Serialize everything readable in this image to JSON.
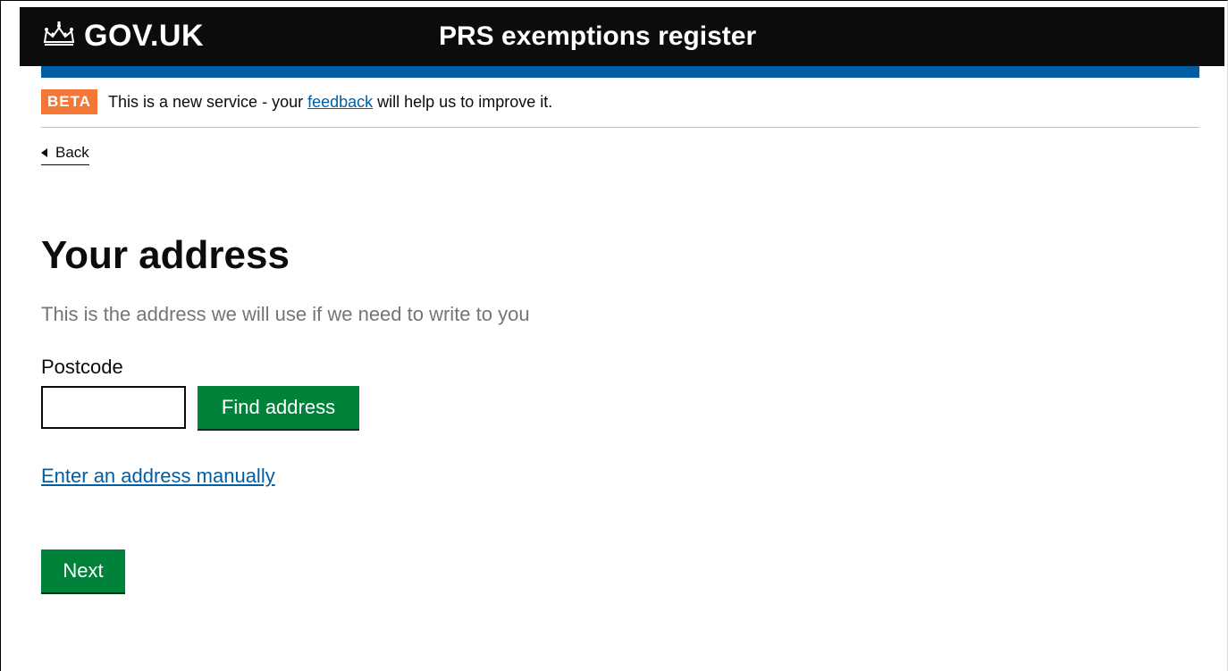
{
  "header": {
    "logo_text": "GOV.UK",
    "service_name": "PRS exemptions register"
  },
  "phase_banner": {
    "tag": "BETA",
    "text_before": "This is a new service - your ",
    "link_text": "feedback",
    "text_after": " will help us to improve it."
  },
  "back_link": {
    "label": "Back"
  },
  "main": {
    "title": "Your address",
    "hint": "This is the address we will use if we need to write to you",
    "postcode_label": "Postcode",
    "postcode_value": "",
    "find_button_label": "Find address",
    "manual_link_text": "Enter an address manually",
    "next_button_label": "Next"
  },
  "colors": {
    "header_bg": "#0b0c0c",
    "header_accent": "#005ea5",
    "beta_tag": "#f47738",
    "button_green": "#00823b",
    "link_blue": "#005ea5",
    "hint_grey": "#6f777b"
  },
  "icons": {
    "logo_icon": "crown-icon",
    "back_icon": "triangle-left-icon"
  }
}
